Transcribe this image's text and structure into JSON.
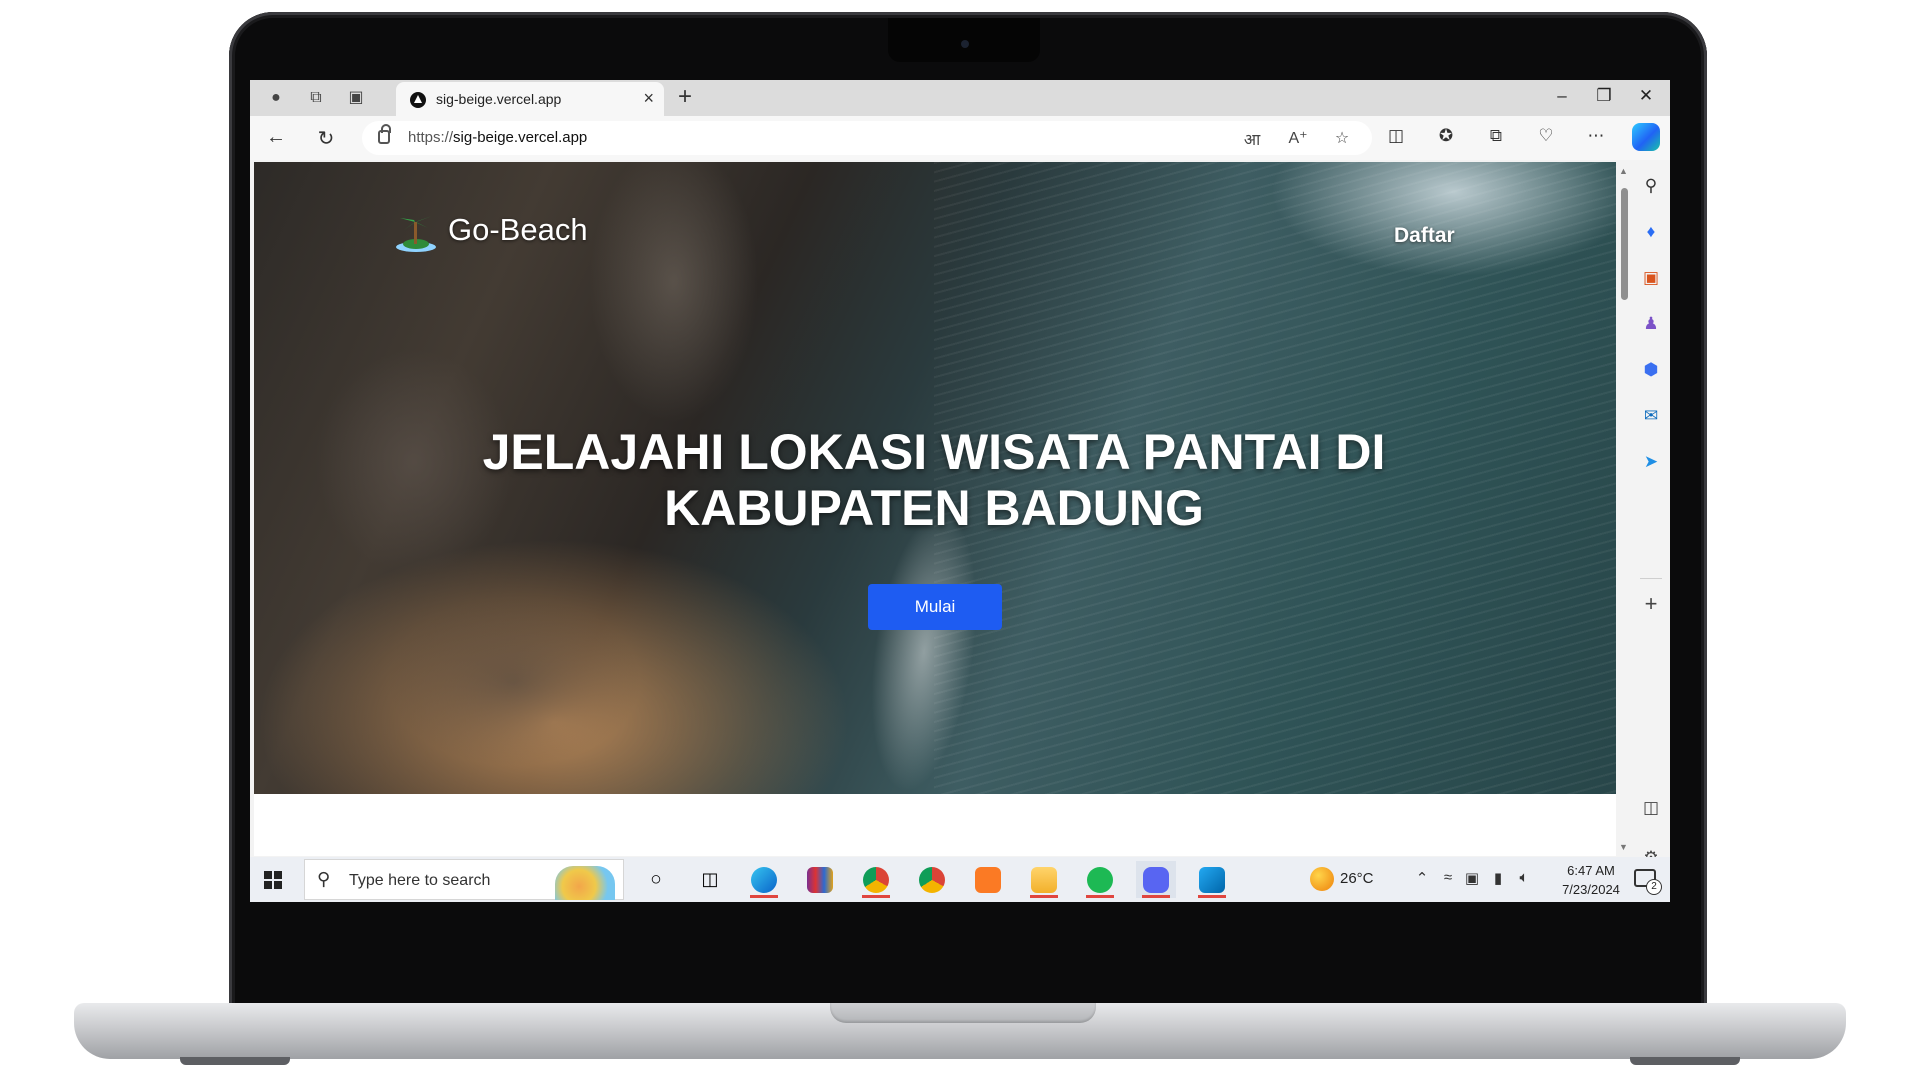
{
  "browser": {
    "tab_title": "sig-beige.vercel.app",
    "url_scheme": "https://",
    "url_host": "sig-beige.vercel.app",
    "new_tab_icon": "plus-icon",
    "tab_close_icon": "close-icon"
  },
  "page": {
    "brand": "Go-Beach",
    "nav_register": "Daftar",
    "headline_line1": "JELAJAHI LOKASI WISATA PANTAI DI",
    "headline_line2": "KABUPATEN BADUNG",
    "cta_label": "Mulai",
    "cta_color": "#1e5cf2"
  },
  "taskbar": {
    "search_placeholder": "Type here to search",
    "temperature": "26°C",
    "time": "6:47 AM",
    "date": "7/23/2024",
    "notification_count": "2"
  }
}
